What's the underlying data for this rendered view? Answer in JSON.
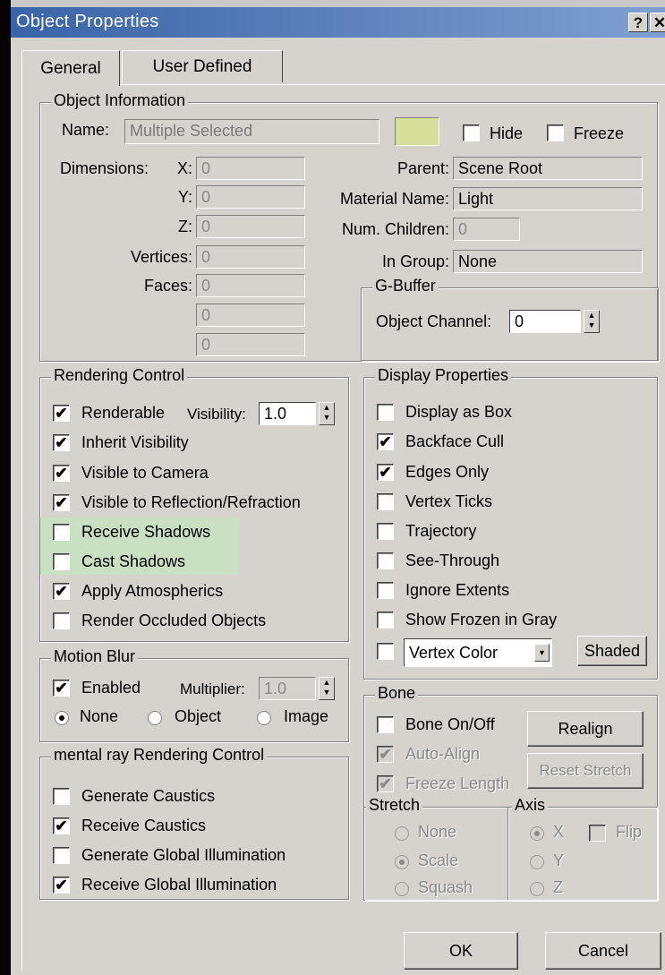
{
  "window": {
    "title": "Object Properties",
    "help_btn": "?",
    "close_btn": "✕"
  },
  "tabs": {
    "general": "General",
    "user_defined": "User Defined"
  },
  "object_info": {
    "legend": "Object Information",
    "name_label": "Name:",
    "name_value": "Multiple Selected",
    "swatch_color": "#d6e09a",
    "hide_label": "Hide",
    "freeze_label": "Freeze",
    "dimensions_label": "Dimensions:",
    "x_label": "X:",
    "x_value": "0",
    "y_label": "Y:",
    "y_value": "0",
    "z_label": "Z:",
    "z_value": "0",
    "vertices_label": "Vertices:",
    "vertices_value": "0",
    "faces_label": "Faces:",
    "faces_value": "0",
    "extra1_value": "0",
    "extra2_value": "0",
    "parent_label": "Parent:",
    "parent_value": "Scene Root",
    "material_label": "Material Name:",
    "material_value": "Light",
    "children_label": "Num. Children:",
    "children_value": "0",
    "group_label": "In Group:",
    "group_value": "None",
    "gbuffer_legend": "G-Buffer",
    "channel_label": "Object Channel:",
    "channel_value": "0"
  },
  "rendering": {
    "legend": "Rendering Control",
    "renderable": "Renderable",
    "visibility_label": "Visibility:",
    "visibility_value": "1.0",
    "inherit": "Inherit Visibility",
    "visible_camera": "Visible to Camera",
    "visible_reflection": "Visible to Reflection/Refraction",
    "receive_shadows": "Receive Shadows",
    "cast_shadows": "Cast Shadows",
    "apply_atmospherics": "Apply Atmospherics",
    "render_occluded": "Render Occluded Objects",
    "highlight_color": "#c9e0c3"
  },
  "display": {
    "legend": "Display Properties",
    "display_box": "Display as Box",
    "backface_cull": "Backface Cull",
    "edges_only": "Edges Only",
    "vertex_ticks": "Vertex Ticks",
    "trajectory": "Trajectory",
    "see_through": "See-Through",
    "ignore_extents": "Ignore Extents",
    "frozen_gray": "Show Frozen in Gray",
    "vertex_color": "Vertex Color",
    "shaded": "Shaded"
  },
  "motion_blur": {
    "legend": "Motion Blur",
    "enabled": "Enabled",
    "multiplier_label": "Multiplier:",
    "multiplier_value": "1.0",
    "none": "None",
    "object": "Object",
    "image": "Image"
  },
  "mental_ray": {
    "legend": "mental ray Rendering Control",
    "gen_caustics": "Generate Caustics",
    "recv_caustics": "Receive Caustics",
    "gen_gi": "Generate Global Illumination",
    "recv_gi": "Receive Global Illumination"
  },
  "bone": {
    "legend": "Bone",
    "on_off": "Bone On/Off",
    "realign": "Realign",
    "auto_align": "Auto-Align",
    "freeze_length": "Freeze Length",
    "reset_stretch": "Reset Stretch",
    "stretch_legend": "Stretch",
    "none": "None",
    "scale": "Scale",
    "squash": "Squash",
    "axis_legend": "Axis",
    "x": "X",
    "y": "Y",
    "z": "Z",
    "flip": "Flip"
  },
  "footer": {
    "ok": "OK",
    "cancel": "Cancel"
  }
}
